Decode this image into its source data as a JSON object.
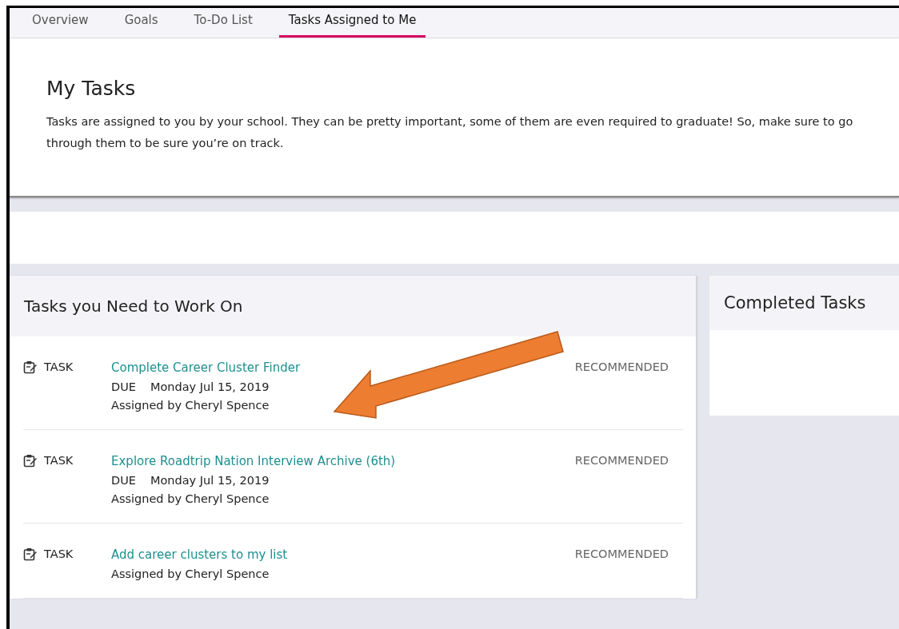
{
  "tabs": [
    {
      "label": "Overview",
      "selected": false
    },
    {
      "label": "Goals",
      "selected": false
    },
    {
      "label": "To-Do List",
      "selected": false
    },
    {
      "label": "Tasks Assigned to Me",
      "selected": true
    }
  ],
  "intro": {
    "title": "My Tasks",
    "text": "Tasks are assigned to you by your school. They can be pretty important, some of them are even required to graduate! So, make sure to go through them to be sure you’re on track."
  },
  "work_on": {
    "title": "Tasks you Need to Work On",
    "tasks": [
      {
        "type": "TASK",
        "title": "Complete Career Cluster Finder",
        "due_label": "DUE",
        "due": "Monday Jul 15, 2019",
        "assigned": "Assigned by Cheryl Spence",
        "tag": "RECOMMENDED"
      },
      {
        "type": "TASK",
        "title": "Explore Roadtrip Nation Interview Archive (6th)",
        "due_label": "DUE",
        "due": "Monday Jul 15, 2019",
        "assigned": "Assigned by Cheryl Spence",
        "tag": "RECOMMENDED"
      },
      {
        "type": "TASK",
        "title": "Add career clusters to my list",
        "assigned": "Assigned by Cheryl Spence",
        "tag": "RECOMMENDED"
      }
    ]
  },
  "completed": {
    "title": "Completed Tasks"
  }
}
